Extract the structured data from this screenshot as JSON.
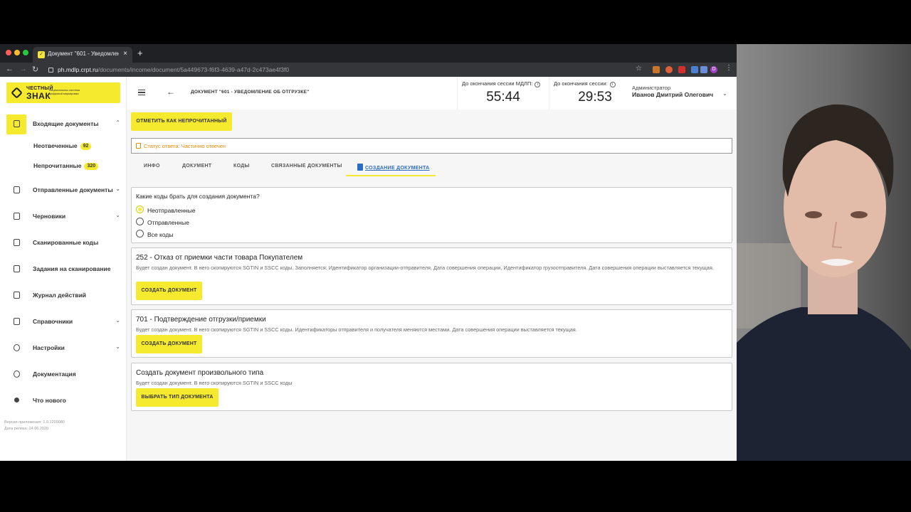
{
  "browser": {
    "tab_title": "Документ \"601 - Уведомление об отгрузке\"",
    "url_host": "ph.mdlp.crpt.ru",
    "url_path": "/documents/income/document/5a449673-f6f3-4639-a47d-2c473ae4f3f0",
    "profile_initial": "D"
  },
  "logo": {
    "line1": "ЧЕСТНЫЙ",
    "line2": "ЗНАК",
    "sub": "национальная система цифровой маркировки"
  },
  "sidebar": {
    "items": [
      {
        "label": "Входящие документы",
        "chev": "⌃"
      },
      {
        "label": "Отправленные документы",
        "chev": "⌄"
      },
      {
        "label": "Черновики",
        "chev": "⌄"
      },
      {
        "label": "Сканированные коды",
        "chev": ""
      },
      {
        "label": "Задания на сканирование",
        "chev": ""
      },
      {
        "label": "Журнал действий",
        "chev": ""
      },
      {
        "label": "Справочники",
        "chev": "⌄"
      },
      {
        "label": "Настройки",
        "chev": "⌄"
      },
      {
        "label": "Документация",
        "chev": ""
      },
      {
        "label": "Что нового",
        "chev": ""
      }
    ],
    "sub_items": [
      {
        "label": "Неотвеченные",
        "badge": "92"
      },
      {
        "label": "Непрочитанные",
        "badge": "320"
      }
    ],
    "version": "Версия приложения: 1.0.1209080",
    "release": "Дата релиза: 14.06.2020"
  },
  "header": {
    "doc_title": "ДОКУМЕНТ \"601 - УВЕДОМЛЕНИЕ ОБ ОТГРУЗКЕ\"",
    "timer1_label": "До окончания сессии МДЛП:",
    "timer1_value": "55:44",
    "timer2_label": "До окончания сессии:",
    "timer2_value": "29:53",
    "user_role": "Администратор",
    "user_name": "Иванов Дмитрий Олегович"
  },
  "main": {
    "mark_unread": "ОТМЕТИТЬ КАК НЕПРОЧИТАННЫЙ",
    "status": "Статус ответа: Частично отвечен",
    "tabs": [
      "ИНФО",
      "ДОКУМЕНТ",
      "КОДЫ",
      "СВЯЗАННЫЕ ДОКУМЕНТЫ",
      "СОЗДАНИЕ ДОКУМЕНТА"
    ],
    "question": "Какие коды брать для создания документа?",
    "options": [
      "Неотправленные",
      "Отправленные",
      "Все коды"
    ],
    "cards": [
      {
        "title": "252 - Отказ от приемки части товара Покупателем",
        "desc": "Будет создан документ. В него скопируются SGTIN и SSCC коды. Заполняется: Идентификатор организации-отправителя, Дата совершения операции, Идентификатор грузоотправителя. Дата совершения операции выставляется текущая.",
        "button": "СОЗДАТЬ ДОКУМЕНТ"
      },
      {
        "title": "701 - Подтверждение отгрузки/приемки",
        "desc": "Будет создан документ. В него скопируются SGTIN и SSCC коды. Идентификаторы отправителя и получателя меняются местами. Дата совершения операции выставляется текущая.",
        "button": "СОЗДАТЬ ДОКУМЕНТ"
      },
      {
        "title": "Создать документ произвольного типа",
        "desc": "Будет создан документ. В него скопируются SGTIN и SSCC коды",
        "button": "ВЫБРАТЬ ТИП ДОКУМЕНТА"
      }
    ]
  },
  "colors": {
    "accent_yellow": "#f6ea2e",
    "status_orange": "#e38a00",
    "link_blue": "#2b6cc4"
  }
}
